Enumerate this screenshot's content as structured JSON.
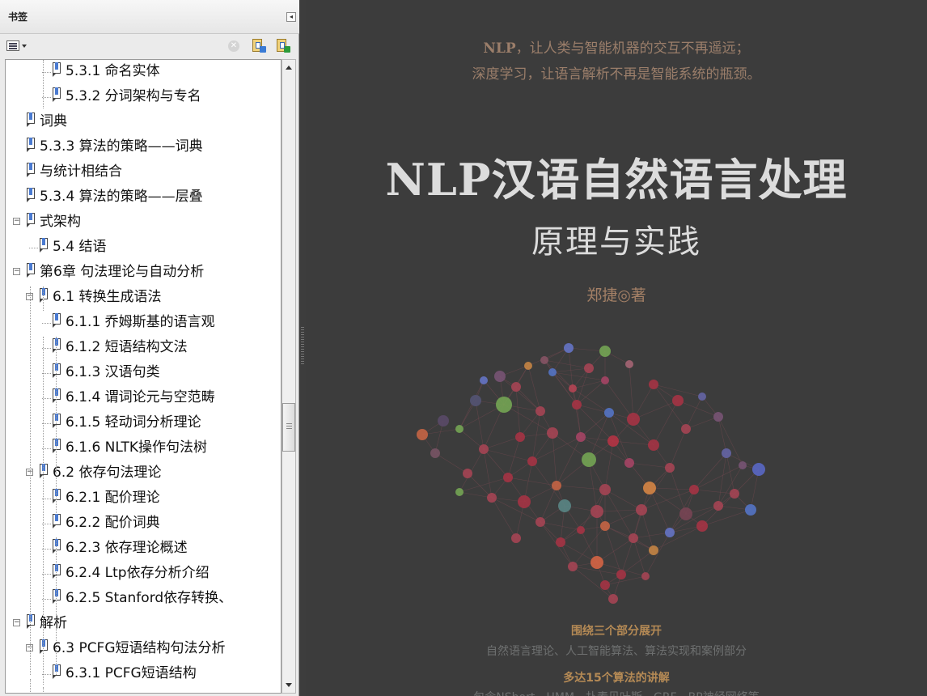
{
  "panel": {
    "title": "书签",
    "collapse_icon": "collapse-left-icon",
    "toolbar": {
      "options_icon": "options-menu-icon",
      "delete_icon": "delete-bookmark-icon",
      "new_icon": "new-bookmark-icon",
      "expand_icon": "expand-bookmark-icon"
    }
  },
  "bookmarks": [
    {
      "label": "5.3.1 命名实体",
      "level": 2,
      "toggle": ""
    },
    {
      "label": "5.3.2 分词架构与专名",
      "level": 2,
      "toggle": ""
    },
    {
      "label": "词典",
      "level": 0,
      "toggle": ""
    },
    {
      "label": "5.3.3 算法的策略——词典",
      "level": 0,
      "toggle": ""
    },
    {
      "label": "与统计相结合",
      "level": 0,
      "toggle": ""
    },
    {
      "label": "5.3.4 算法的策略——层叠",
      "level": 0,
      "toggle": ""
    },
    {
      "label": "式架构",
      "level": 0,
      "toggle": "−"
    },
    {
      "label": "5.4 结语",
      "level": 1,
      "toggle": ""
    },
    {
      "label": "第6章 句法理论与自动分析",
      "level": 0,
      "toggle": "−"
    },
    {
      "label": "6.1 转换生成语法",
      "level": 1,
      "toggle": "−"
    },
    {
      "label": "6.1.1 乔姆斯基的语言观",
      "level": 2,
      "toggle": ""
    },
    {
      "label": "6.1.2 短语结构文法",
      "level": 2,
      "toggle": ""
    },
    {
      "label": "6.1.3 汉语句类",
      "level": 2,
      "toggle": ""
    },
    {
      "label": "6.1.4 谓词论元与空范畴",
      "level": 2,
      "toggle": ""
    },
    {
      "label": "6.1.5 轻动词分析理论",
      "level": 2,
      "toggle": ""
    },
    {
      "label": "6.1.6 NLTK操作句法树",
      "level": 2,
      "toggle": ""
    },
    {
      "label": "6.2 依存句法理论",
      "level": 1,
      "toggle": "−"
    },
    {
      "label": "6.2.1 配价理论",
      "level": 2,
      "toggle": ""
    },
    {
      "label": "6.2.2 配价词典",
      "level": 2,
      "toggle": ""
    },
    {
      "label": "6.2.3 依存理论概述",
      "level": 2,
      "toggle": ""
    },
    {
      "label": "6.2.4 Ltp依存分析介绍",
      "level": 2,
      "toggle": ""
    },
    {
      "label": "6.2.5 Stanford依存转换、",
      "level": 2,
      "toggle": ""
    },
    {
      "label": "解析",
      "level": 0,
      "toggle": "−"
    },
    {
      "label": "6.3 PCFG短语结构句法分析",
      "level": 1,
      "toggle": "−"
    },
    {
      "label": "6.3.1 PCFG短语结构",
      "level": 2,
      "toggle": ""
    }
  ],
  "scrollbar": {
    "up_icon": "scroll-up-arrow-icon",
    "down_icon": "scroll-down-arrow-icon"
  },
  "cover": {
    "tagline_1_bold": "NLP",
    "tagline_1_rest": "，让人类与智能机器的交互不再遥远；",
    "tagline_2": "深度学习，让语言解析不再是智能系统的瓶颈。",
    "title": "NLP汉语自然语言处理",
    "subtitle": "原理与实践",
    "author": "郑捷◎著",
    "feature_1_title": "围绕三个部分展开",
    "feature_1_desc": "自然语言理论、人工智能算法、算法实现和案例部分",
    "feature_2_title": "多达15个算法的讲解",
    "feature_2_desc": "包含NShort、HMM、扑素贝叶斯、GRF、BP神经网络等",
    "brain_image": "neural-network-brain-illustration"
  },
  "colors": {
    "panel_bg": "#ebebeb",
    "cover_bg": "#3c3c3c",
    "tagline": "#9b7e6a",
    "title": "#dcdcdc",
    "feature_title": "#b58a55"
  }
}
